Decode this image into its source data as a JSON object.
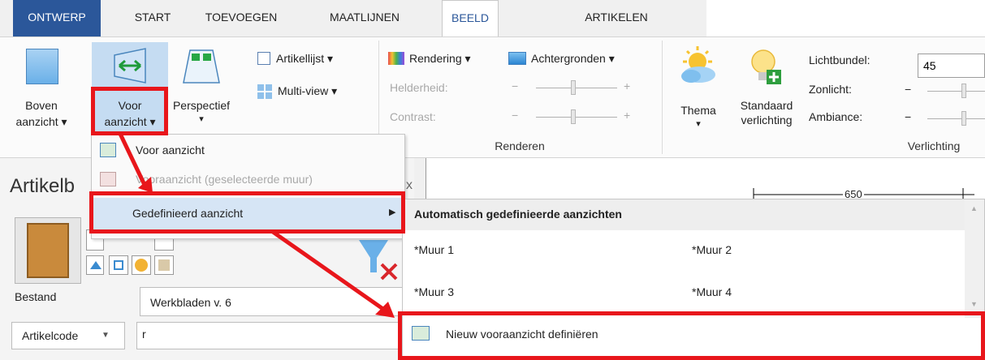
{
  "tabs": [
    {
      "label": "ONTWERP",
      "state": "file"
    },
    {
      "label": "START",
      "state": "normal"
    },
    {
      "label": "TOEVOEGEN",
      "state": "normal"
    },
    {
      "label": "MAATLIJNEN",
      "state": "normal"
    },
    {
      "label": "BEELD",
      "state": "active"
    },
    {
      "label": "ARTIKELEN",
      "state": "normal"
    }
  ],
  "ribbon": {
    "views": {
      "boven_line1": "Boven",
      "boven_line2": "aanzicht ▾",
      "voor_line1": "Voor",
      "voor_line2": "aanzicht ▾",
      "perspectief": "Perspectief",
      "perspectief_arrow": "▾",
      "artikellijst": "Artikellijst ▾",
      "multiview": "Multi-view ▾"
    },
    "renderen": {
      "rendering": "Rendering ▾",
      "achtergronden": "Achtergronden ▾",
      "helderheid": "Helderheid:",
      "contrast": "Contrast:",
      "minus": "−",
      "plus": "+",
      "group_title": "Renderen"
    },
    "verlichting": {
      "thema": "Thema",
      "thema_arrow": "▾",
      "standaard_line1": "Standaard",
      "standaard_line2": "verlichting",
      "lichtbundel": "Lichtbundel:",
      "lichtbundel_value": "45",
      "zonlicht": "Zonlicht:",
      "ambiance": "Ambiance:",
      "minus": "−",
      "group_title": "Verlichting"
    }
  },
  "left_panel": {
    "title": "Artikelb",
    "bestand_label": "Bestand",
    "bestand_value": "Werkbladen v. 6",
    "artikelcode_label": "Artikelcode",
    "search_value": "r",
    "x_glyph": "x"
  },
  "drawing": {
    "dimension_label": "650"
  },
  "dropdown_menu": {
    "items": [
      {
        "label": "Voor aanzicht",
        "enabled": true
      },
      {
        "label": "Vooraanzicht (geselecteerde muur)",
        "enabled": false
      },
      {
        "label": "Gedefinieerd aanzicht",
        "enabled": true,
        "submenu_arrow": "▶"
      }
    ]
  },
  "submenu": {
    "header": "Automatisch gedefinieerde aanzichten",
    "walls": [
      "*Muur 1",
      "*Muur 2",
      "*Muur 3",
      "*Muur 4"
    ],
    "new_view": "Nieuw vooraanzicht definiëren"
  },
  "colors": {
    "ribbon_accent": "#2b579a",
    "annotation_red": "#e8161b",
    "menu_highlight": "#d6e5f5"
  }
}
